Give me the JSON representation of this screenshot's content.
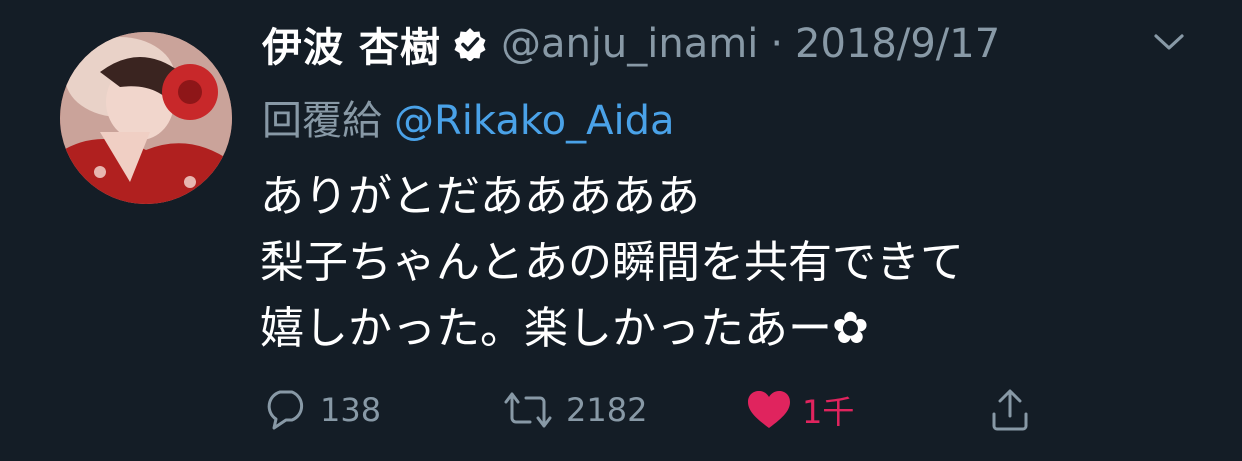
{
  "user": {
    "display_name": "伊波 杏樹",
    "handle": "@anju_inami",
    "separator": "·",
    "date": "2018/9/17"
  },
  "reply": {
    "prefix": "回覆給",
    "mention": "@Rikako_Aida"
  },
  "tweet": {
    "lines": [
      "ありがとだあああああ",
      "梨子ちゃんとあの瞬間を共有できて",
      "嬉しかった。楽しかったあー✿"
    ]
  },
  "actions": {
    "reply_count": "138",
    "retweet_count": "2182",
    "like_count": "1千"
  },
  "colors": {
    "background": "#141d26",
    "muted": "#8899a6",
    "link": "#4aa2e8",
    "like": "#e0245e"
  },
  "icons": {
    "verified": "verified-badge-icon",
    "caret": "chevron-down-icon",
    "reply": "reply-bubble-icon",
    "retweet": "retweet-icon",
    "like": "heart-icon",
    "share": "share-icon"
  }
}
